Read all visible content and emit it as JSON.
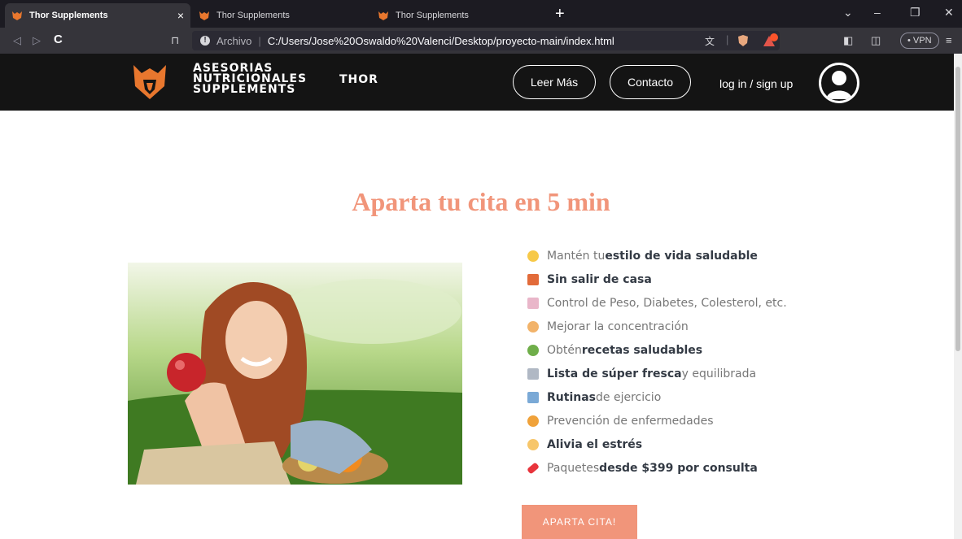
{
  "browser": {
    "tabs": [
      {
        "title": "Thor Supplements",
        "close": "×"
      },
      {
        "title": "Thor Supplements"
      },
      {
        "title": "Thor Supplements"
      }
    ],
    "new_tab": "+",
    "address": {
      "prefix": "Archivo",
      "separator": "|",
      "url": "C:/Users/Jose%20Oswaldo%20Valenci/Desktop/proyecto-main/index.html"
    },
    "vpn_label": "• VPN"
  },
  "site": {
    "brand_line1": "ASESORIAS",
    "brand_line2": "NUTRICIONALES",
    "brand_line3": "SUPPLEMENTS",
    "brand_thor": "THOR",
    "nav": {
      "leer_mas": "Leer Más",
      "contacto": "Contacto",
      "login": "log in / sign up"
    },
    "headline": "Aparta tu cita en 5 min",
    "features": [
      {
        "pre": "Mantén tu ",
        "bold": "estilo de vida saludable",
        "post": "",
        "icon": "smile-emoji-icon"
      },
      {
        "pre": "",
        "bold": "Sin salir de casa",
        "post": "",
        "icon": "house-emoji-icon"
      },
      {
        "pre": "Control de Peso, Diabetes, Colesterol, etc.",
        "bold": "",
        "post": "",
        "icon": "chart-emoji-icon"
      },
      {
        "pre": "Mejorar la concentración",
        "bold": "",
        "post": "",
        "icon": "nerd-emoji-icon"
      },
      {
        "pre": "Obtén ",
        "bold": "recetas saludables",
        "post": "",
        "icon": "salad-emoji-icon"
      },
      {
        "pre": "",
        "bold": "Lista de súper fresca",
        "post": " y equilibrada",
        "icon": "cart-emoji-icon"
      },
      {
        "pre": "",
        "bold": "Rutinas",
        "post": " de ejercicio",
        "icon": "runner-emoji-icon"
      },
      {
        "pre": "Prevención de enfermedades",
        "bold": "",
        "post": "",
        "icon": "mask-emoji-icon"
      },
      {
        "pre": "",
        "bold": "Alivia el estrés",
        "post": "",
        "icon": "relieved-emoji-icon"
      },
      {
        "pre": "Paquetes ",
        "bold": "desde $399 por consulta",
        "post": "",
        "icon": "pill-emoji-icon"
      }
    ],
    "cta": "APARTA CITA!"
  },
  "colors": {
    "accent": "#f1957a",
    "header_bg": "#141414",
    "text_muted": "#777777",
    "text_bold": "#333a44"
  }
}
